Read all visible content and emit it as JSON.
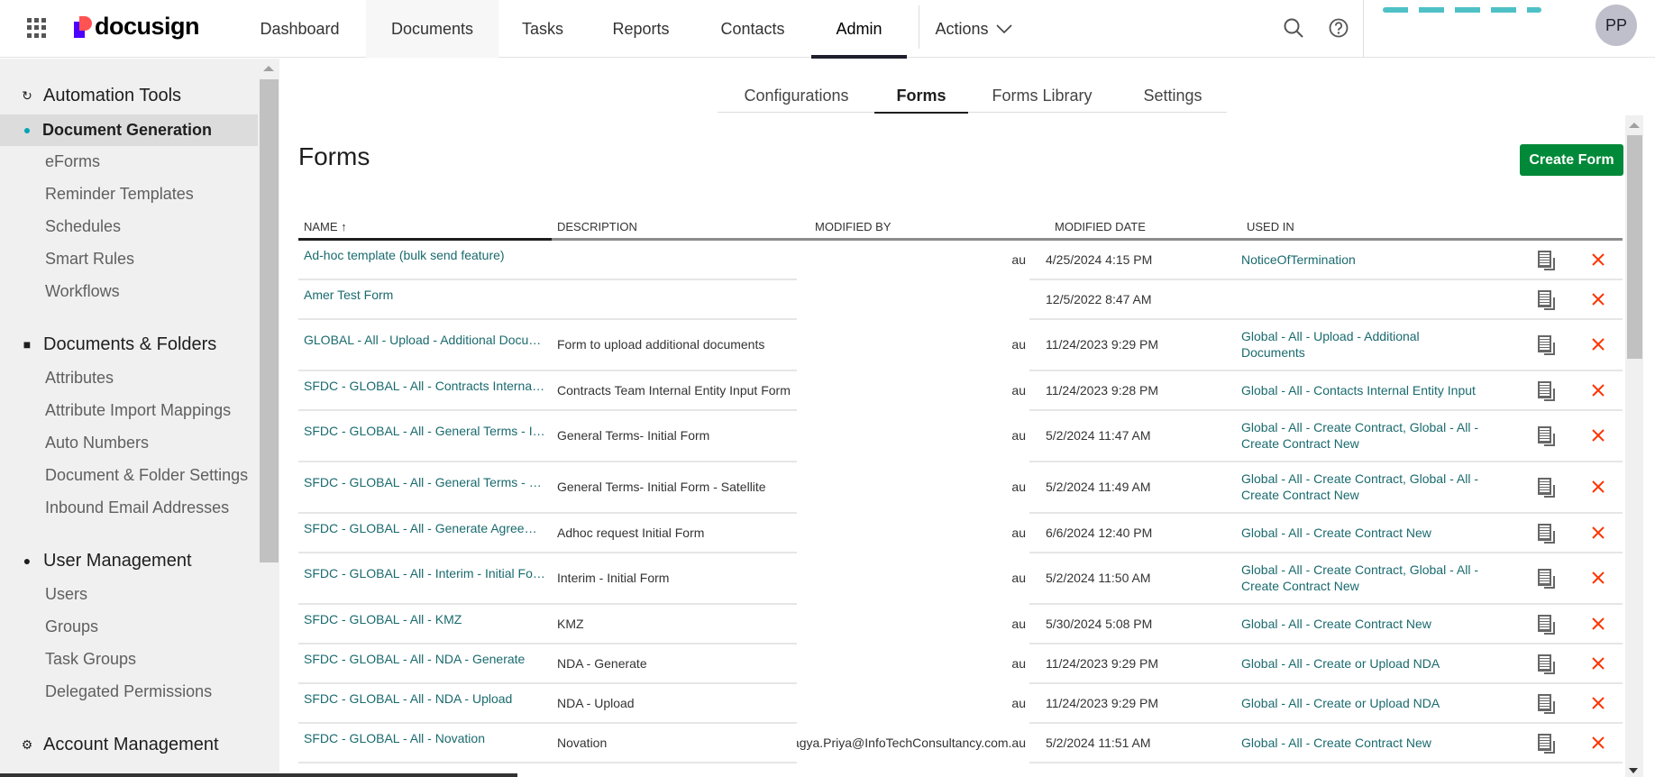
{
  "header": {
    "logo": "docusign",
    "nav": [
      "Dashboard",
      "Documents",
      "Tasks",
      "Reports",
      "Contacts",
      "Admin",
      "Actions"
    ],
    "active_nav": "Admin",
    "avatar_initials": "PP"
  },
  "sidebar": {
    "sections": [
      {
        "title": "Automation Tools",
        "icon": "refresh-icon",
        "items": [
          "Document Generation",
          "eForms",
          "Reminder Templates",
          "Schedules",
          "Smart Rules",
          "Workflows"
        ]
      },
      {
        "title": "Documents & Folders",
        "icon": "folder-icon",
        "items": [
          "Attributes",
          "Attribute Import Mappings",
          "Auto Numbers",
          "Document & Folder Settings",
          "Inbound Email Addresses"
        ]
      },
      {
        "title": "User Management",
        "icon": "user-icon",
        "items": [
          "Users",
          "Groups",
          "Task Groups",
          "Delegated Permissions"
        ]
      },
      {
        "title": "Account Management",
        "icon": "gear-icon",
        "items": []
      }
    ],
    "active_item": "Document Generation"
  },
  "subtabs": [
    "Configurations",
    "Forms",
    "Forms Library",
    "Settings"
  ],
  "active_subtab": "Forms",
  "page": {
    "title": "Forms",
    "create_button": "Create Form"
  },
  "table": {
    "columns": [
      "NAME ↑",
      "DESCRIPTION",
      "MODIFIED BY",
      "MODIFIED DATE",
      "USED IN"
    ],
    "rows": [
      {
        "name": "Ad-hoc template (bulk send feature)",
        "description": "",
        "modified_by": "au",
        "modified_date": "4/25/2024 4:15 PM",
        "used_in": "NoticeOfTermination"
      },
      {
        "name": "Amer Test Form",
        "description": "",
        "modified_by": "",
        "modified_date": "12/5/2022 8:47 AM",
        "used_in": ""
      },
      {
        "name": "GLOBAL - All - Upload - Additional Docume...",
        "description": "Form to upload additional documents",
        "modified_by": "au",
        "modified_date": "11/24/2023 9:29 PM",
        "used_in": "Global - All - Upload - Additional Documents"
      },
      {
        "name": "SFDC - GLOBAL - All - Contracts Internal E...",
        "description": "Contracts Team Internal Entity Input Form",
        "modified_by": "au",
        "modified_date": "11/24/2023 9:28 PM",
        "used_in": "Global - All - Contacts Internal Entity Input"
      },
      {
        "name": "SFDC - GLOBAL - All - General Terms - Initi...",
        "description": "General Terms- Initial Form",
        "modified_by": "au",
        "modified_date": "5/2/2024 11:47 AM",
        "used_in": "Global - All - Create Contract, Global - All - Create Contract New"
      },
      {
        "name": "SFDC - GLOBAL - All - General Terms - Sate...",
        "description": "General Terms- Initial Form - Satellite",
        "modified_by": "au",
        "modified_date": "5/2/2024 11:49 AM",
        "used_in": "Global - All - Create Contract, Global - All - Create Contract New"
      },
      {
        "name": "SFDC - GLOBAL - All - Generate Agreemen...",
        "description": "Adhoc request Initial Form",
        "modified_by": "au",
        "modified_date": "6/6/2024 12:40 PM",
        "used_in": "Global - All - Create Contract New"
      },
      {
        "name": "SFDC - GLOBAL - All - Interim - Initial Form",
        "description": "Interim - Initial Form",
        "modified_by": "au",
        "modified_date": "5/2/2024 11:50 AM",
        "used_in": "Global - All - Create Contract, Global - All - Create Contract New"
      },
      {
        "name": "SFDC - GLOBAL - All - KMZ",
        "description": "KMZ",
        "modified_by": "au",
        "modified_date": "5/30/2024 5:08 PM",
        "used_in": "Global - All - Create Contract New"
      },
      {
        "name": "SFDC - GLOBAL - All - NDA - Generate",
        "description": "NDA - Generate",
        "modified_by": "au",
        "modified_date": "11/24/2023 9:29 PM",
        "used_in": "Global - All - Create or Upload NDA"
      },
      {
        "name": "SFDC - GLOBAL - All - NDA - Upload",
        "description": "NDA - Upload",
        "modified_by": "au",
        "modified_date": "11/24/2023 9:29 PM",
        "used_in": "Global - All - Create or Upload NDA"
      },
      {
        "name": "SFDC - GLOBAL - All - Novation",
        "description": "Novation",
        "modified_by": "Pragya.Priya@InfoTechConsultancy.com.au",
        "modified_date": "5/2/2024 11:51 AM",
        "used_in": "Global - All - Create Contract New"
      }
    ]
  },
  "colors": {
    "accent_green": "#008938",
    "link_teal": "#1a6a6e",
    "delete_red": "#ff3300",
    "active_dot": "#00a3b4"
  }
}
